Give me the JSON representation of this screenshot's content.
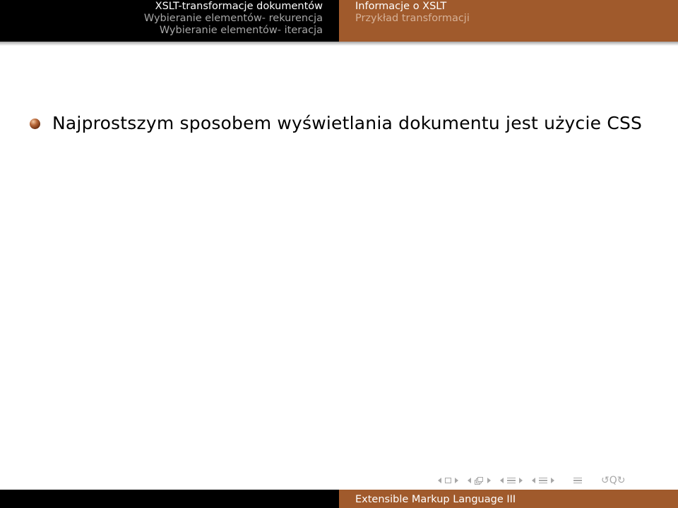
{
  "header": {
    "left_sections": [
      {
        "label": "XSLT-transformacje dokumentów",
        "current": true
      },
      {
        "label": "Wybieranie elementów- rekurencja",
        "current": false
      },
      {
        "label": "Wybieranie elementów- iteracja",
        "current": false
      }
    ],
    "right_subsections": [
      {
        "label": "Informacje o XSLT",
        "current": true
      },
      {
        "label": "Przykład transformacji",
        "current": false
      }
    ]
  },
  "content": {
    "items": [
      {
        "text": "Najprostszym sposobem wyświetlania dokumentu jest użycie CSS",
        "bullet": "ball-bullet-icon"
      }
    ]
  },
  "navigation_symbols": {
    "icons": [
      "slide-nav-icon",
      "frame-nav-icon",
      "subsection-nav-icon",
      "section-nav-icon",
      "document-nav-icon",
      "search-icon"
    ],
    "search_glyph": "↺Q↻"
  },
  "footer": {
    "left_text": "",
    "title": "Extensible Markup Language III"
  },
  "colors": {
    "header_left_bg": "#000000",
    "header_right_bg": "#a05a2c",
    "bullet": "#8b4513",
    "text": "#000000"
  }
}
